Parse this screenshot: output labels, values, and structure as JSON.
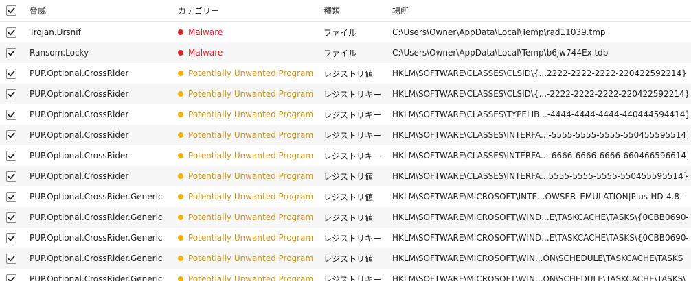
{
  "header": {
    "threat": "脅威",
    "category": "カテゴリー",
    "type": "種類",
    "location": "場所"
  },
  "colors": {
    "malware": "#d9262c",
    "pup": "#f0b400",
    "pup_text": "#c8962a",
    "malware_text": "#d9262c"
  },
  "rows": [
    {
      "threat": "Trojan.Ursnif",
      "category": "Malware",
      "kind": "malware",
      "type": "ファイル",
      "location": "C:\\Users\\Owner\\AppData\\Local\\Temp\\rad11039.tmp",
      "checked": true
    },
    {
      "threat": "Ransom.Locky",
      "category": "Malware",
      "kind": "malware",
      "type": "ファイル",
      "location": "C:\\Users\\Owner\\AppData\\Local\\Temp\\b6jw744Ex.tdb",
      "checked": true
    },
    {
      "threat": "PUP.Optional.CrossRider",
      "category": "Potentially Unwanted Program",
      "kind": "pup",
      "type": "レジストリ値",
      "location": "HKLM\\SOFTWARE\\CLASSES\\CLSID\\{...2222-2222-2222-220422592214}|",
      "checked": true
    },
    {
      "threat": "PUP.Optional.CrossRider",
      "category": "Potentially Unwanted Program",
      "kind": "pup",
      "type": "レジストリキー",
      "location": "HKLM\\SOFTWARE\\CLASSES\\CLSID\\{...-2222-2222-2222-220422592214}",
      "checked": true
    },
    {
      "threat": "PUP.Optional.CrossRider",
      "category": "Potentially Unwanted Program",
      "kind": "pup",
      "type": "レジストリキー",
      "location": "HKLM\\SOFTWARE\\CLASSES\\TYPELIB...-4444-4444-4444-440444594414}",
      "checked": true
    },
    {
      "threat": "PUP.Optional.CrossRider",
      "category": "Potentially Unwanted Program",
      "kind": "pup",
      "type": "レジストリキー",
      "location": "HKLM\\SOFTWARE\\CLASSES\\INTERFA...-5555-5555-5555-550455595514}",
      "checked": true
    },
    {
      "threat": "PUP.Optional.CrossRider",
      "category": "Potentially Unwanted Program",
      "kind": "pup",
      "type": "レジストリキー",
      "location": "HKLM\\SOFTWARE\\CLASSES\\INTERFA...-6666-6666-6666-660466596614}",
      "checked": true
    },
    {
      "threat": "PUP.Optional.CrossRider",
      "category": "Potentially Unwanted Program",
      "kind": "pup",
      "type": "レジストリ値",
      "location": "HKLM\\SOFTWARE\\CLASSES\\INTERFA...5555-5555-5555-550455595514}|",
      "checked": true
    },
    {
      "threat": "PUP.Optional.CrossRider.Generic",
      "category": "Potentially Unwanted Program",
      "kind": "pup",
      "type": "レジストリ値",
      "location": "HKLM\\SOFTWARE\\MICROSOFT\\INTE...OWSER_EMULATION|Plus-HD-4.8-",
      "checked": true
    },
    {
      "threat": "PUP.Optional.CrossRider.Generic",
      "category": "Potentially Unwanted Program",
      "kind": "pup",
      "type": "レジストリ値",
      "location": "HKLM\\SOFTWARE\\MICROSOFT\\WIND...E\\TASKCACHE\\TASKS\\{0CBB0690-",
      "checked": true
    },
    {
      "threat": "PUP.Optional.CrossRider.Generic",
      "category": "Potentially Unwanted Program",
      "kind": "pup",
      "type": "レジストリキー",
      "location": "HKLM\\SOFTWARE\\MICROSOFT\\WIND...E\\TASKCACHE\\TASKS\\{0CBB0690-",
      "checked": true
    },
    {
      "threat": "PUP.Optional.CrossRider.Generic",
      "category": "Potentially Unwanted Program",
      "kind": "pup",
      "type": "レジストリ値",
      "location": "HKLM\\SOFTWARE\\MICROSOFT\\WIN...ON\\SCHEDULE\\TASKCACHE\\TASKS",
      "checked": true
    },
    {
      "threat": "PUP.Optional.CrossRider.Generic",
      "category": "Potentially Unwanted Program",
      "kind": "pup",
      "type": "レジストリキー",
      "location": "HKLM\\SOFTWARE\\MICROSOFT\\WIN...ON\\SCHEDULE\\TASKCACHE\\TASKS\\",
      "checked": true
    }
  ]
}
